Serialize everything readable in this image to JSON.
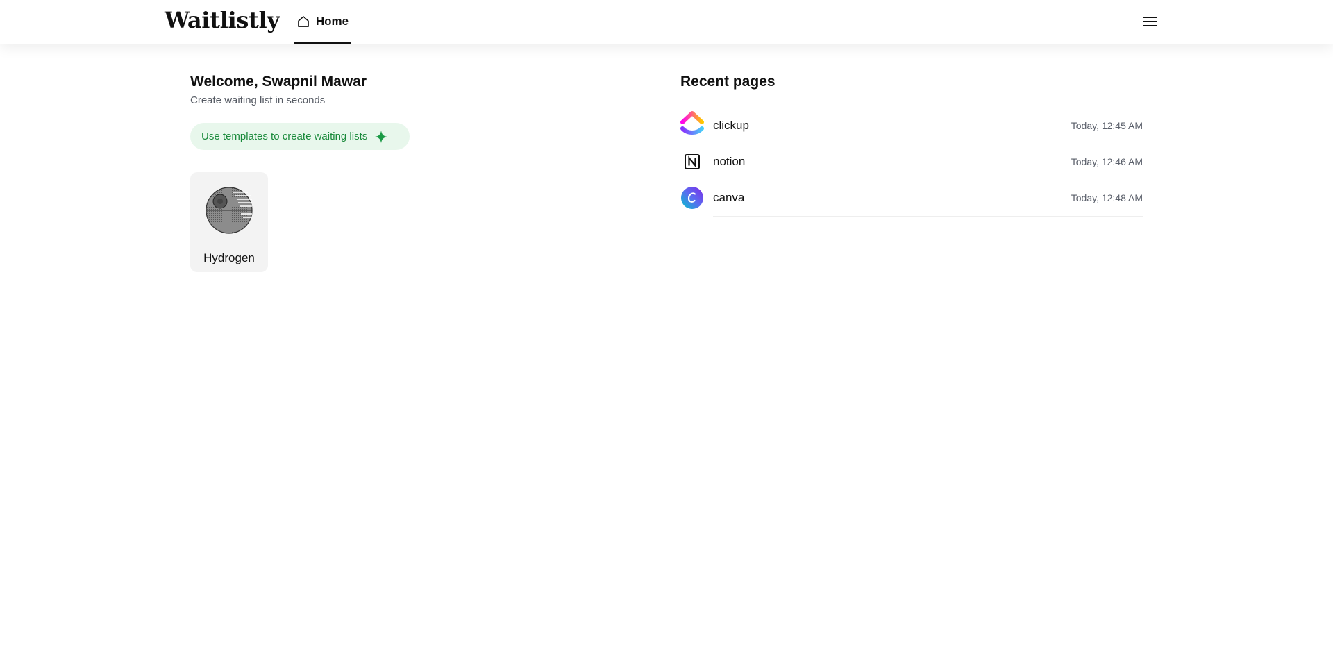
{
  "header": {
    "logo": "Waitlistly",
    "nav": {
      "home_label": "Home",
      "home_icon": "home-icon"
    },
    "menu_icon": "hamburger-menu-icon"
  },
  "welcome": {
    "title": "Welcome, Swapnil Mawar",
    "subtitle": "Create waiting list in seconds",
    "templates_button": "Use templates to create waiting lists",
    "templates_icon": "sparkle-icon"
  },
  "pages": [
    {
      "name": "Hydrogen",
      "thumbnail_icon": "death-star-icon"
    }
  ],
  "recent": {
    "title": "Recent pages",
    "items": [
      {
        "name": "clickup",
        "time": "Today, 12:45 AM",
        "icon": "clickup-logo-icon"
      },
      {
        "name": "notion",
        "time": "Today, 12:46 AM",
        "icon": "notion-logo-icon"
      },
      {
        "name": "canva",
        "time": "Today, 12:48 AM",
        "icon": "canva-logo-icon"
      }
    ]
  },
  "colors": {
    "accent_green": "#1a8a3b",
    "accent_green_bg": "#e8f7ec",
    "card_bg": "#f3f3f3",
    "muted_text": "#5b606b"
  }
}
